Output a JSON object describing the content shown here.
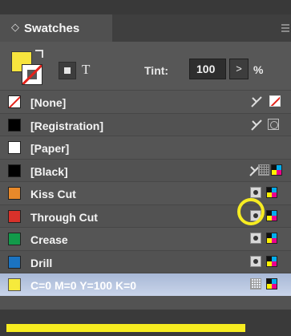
{
  "panel": {
    "title": "Swatches",
    "tab_chevron": "◇"
  },
  "toolbar": {
    "text_button": "T",
    "tint_label": "Tint:",
    "tint_value": "100",
    "tint_arrow": ">",
    "tint_percent": "%"
  },
  "swatches": [
    {
      "label": "[None]",
      "color": "#ffffff"
    },
    {
      "label": "[Registration]",
      "color": "#000000"
    },
    {
      "label": "[Paper]",
      "color": "#ffffff"
    },
    {
      "label": "[Black]",
      "color": "#000000"
    },
    {
      "label": "Kiss Cut",
      "color": "#e8892a"
    },
    {
      "label": "Through Cut",
      "color": "#d8312a"
    },
    {
      "label": "Crease",
      "color": "#129a4a"
    },
    {
      "label": "Drill",
      "color": "#1b73c1"
    },
    {
      "label": "C=0 M=0 Y=100 K=0",
      "color": "#f6ea3c"
    }
  ],
  "colors": {
    "accent_highlight": "#f6ec22",
    "fill_color": "#f7e43e",
    "selected_row": "#b8c6e0"
  }
}
